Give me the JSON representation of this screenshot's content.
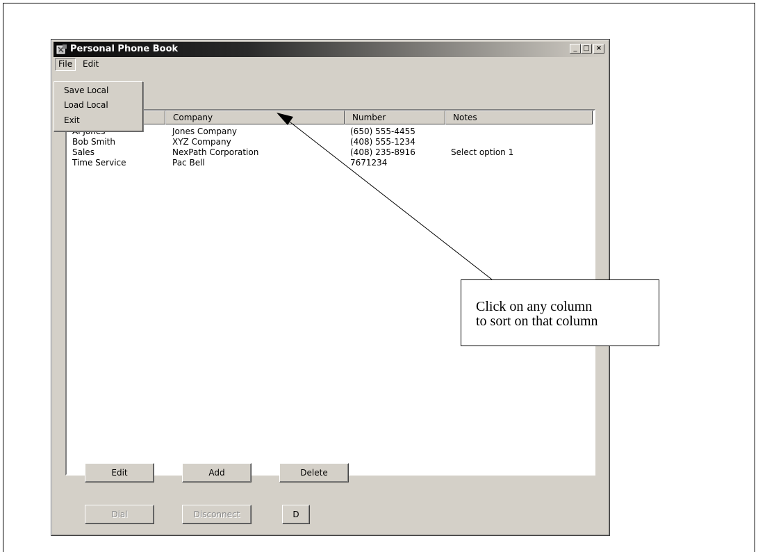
{
  "window": {
    "title": "Personal Phone Book",
    "controls": {
      "minimize": "_",
      "maximize": "□",
      "close": "×"
    }
  },
  "menu": {
    "file": "File",
    "edit": "Edit",
    "file_items": [
      "Save Local",
      "Load Local",
      "Exit"
    ]
  },
  "table": {
    "columns": [
      "Company",
      "Number",
      "Notes"
    ],
    "rows": [
      {
        "name": "Al Jones",
        "company": "Jones Company",
        "number": "(650) 555-4455",
        "notes": ""
      },
      {
        "name": "Bob Smith",
        "company": "XYZ Company",
        "number": "(408) 555-1234",
        "notes": ""
      },
      {
        "name": "Sales",
        "company": "NexPath Corporation",
        "number": "(408) 235-8916",
        "notes": "Select option 1"
      },
      {
        "name": "Time Service",
        "company": "Pac Bell",
        "number": "7671234",
        "notes": ""
      }
    ]
  },
  "buttons": {
    "edit": "Edit",
    "add": "Add",
    "delete": "Delete",
    "dial": "Dial",
    "disconnect": "Disconnect",
    "partial": "D"
  },
  "callout": {
    "line1": "Click on any column",
    "line2": "to sort on that column"
  },
  "icons": {
    "app": "phone-book-icon",
    "arrow": "callout-arrow-icon"
  }
}
